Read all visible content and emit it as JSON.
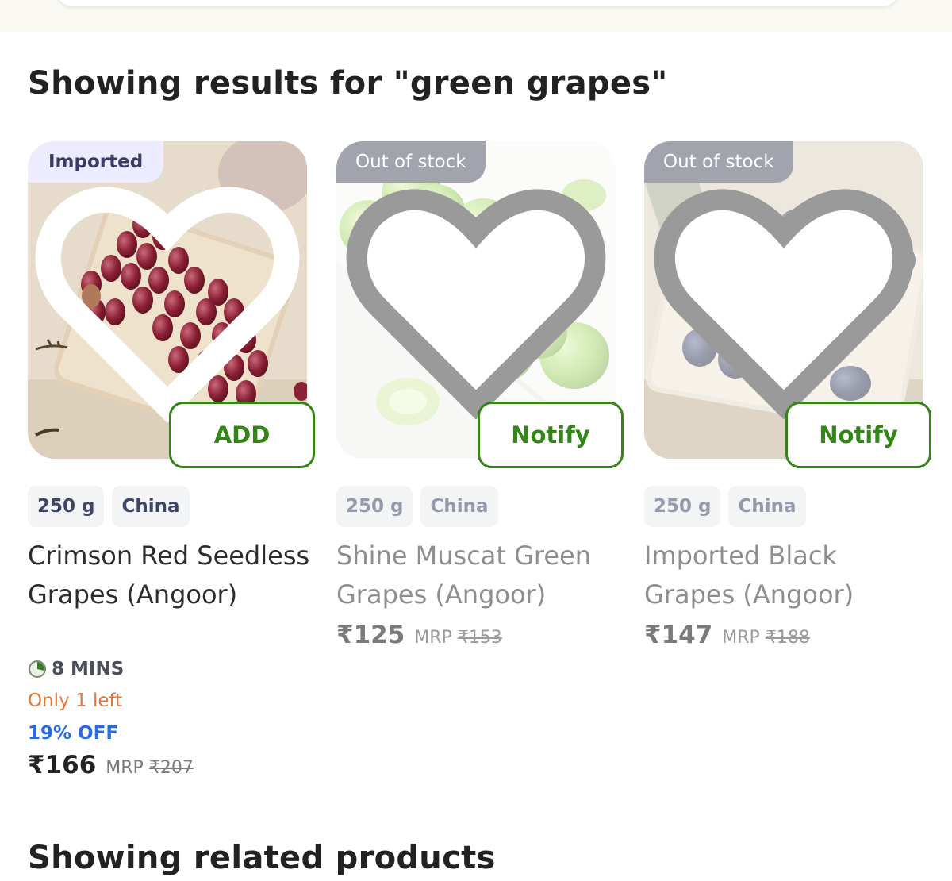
{
  "search": {
    "placeholder": ""
  },
  "results_heading": "Showing results for \"green grapes\"",
  "related_heading": "Showing related products",
  "colors": {
    "accent_green": "#318616",
    "discount_blue": "#2a6ae0",
    "low_stock_orange": "#e2783a"
  },
  "products": [
    {
      "badge": "Imported",
      "action": "ADD",
      "weight": "250 g",
      "origin": "China",
      "name": "Crimson Red Seedless Grapes (Angoor)",
      "eta": "8 MINS",
      "stock_note": "Only 1 left",
      "discount": "19% OFF",
      "price": "₹166",
      "mrp_label": "MRP",
      "mrp": "₹207",
      "icon": "heart-icon"
    },
    {
      "badge": "Out of stock",
      "action": "Notify",
      "weight": "250 g",
      "origin": "China",
      "name": "Shine Muscat Green Grapes (Angoor)",
      "price": "₹125",
      "mrp_label": "MRP",
      "mrp": "₹153",
      "icon": "heart-icon"
    },
    {
      "badge": "Out of stock",
      "action": "Notify",
      "weight": "250 g",
      "origin": "China",
      "name": "Imported Black Grapes (Angoor)",
      "price": "₹147",
      "mrp_label": "MRP",
      "mrp": "₹188",
      "icon": "heart-icon"
    }
  ]
}
